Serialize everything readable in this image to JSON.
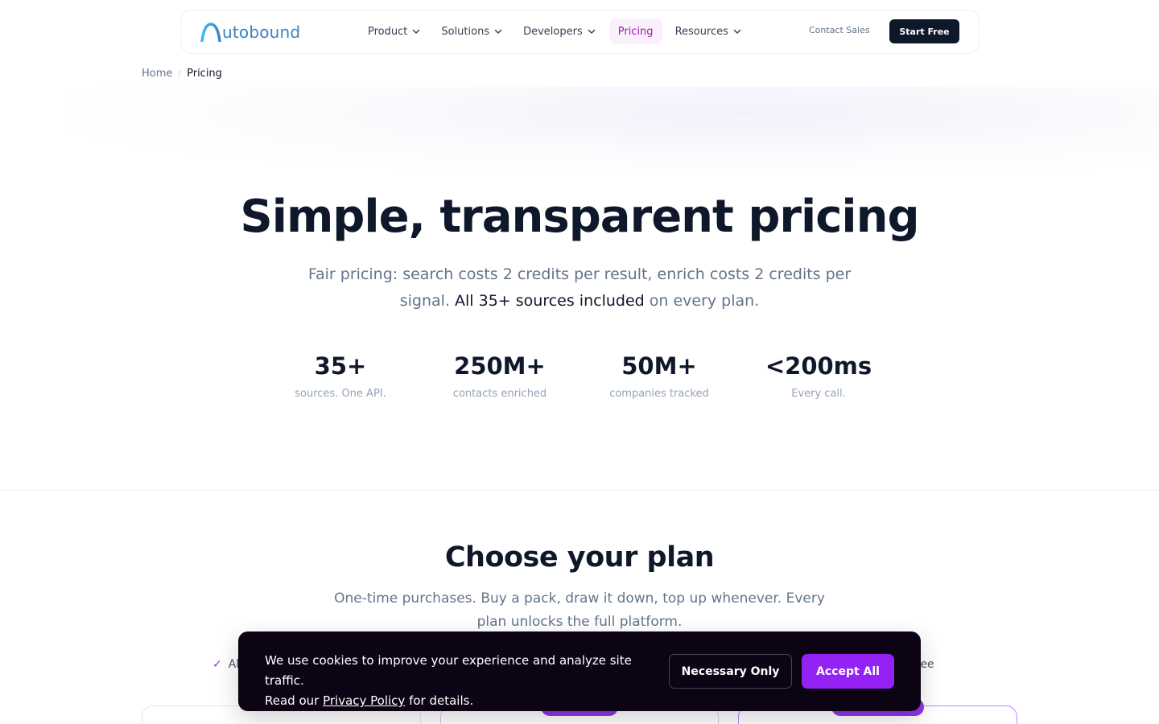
{
  "nav": {
    "logo_text": "utobound",
    "menu": [
      {
        "label": "Product",
        "has_dropdown": true
      },
      {
        "label": "Solutions",
        "has_dropdown": true
      },
      {
        "label": "Developers",
        "has_dropdown": true
      },
      {
        "label": "Pricing",
        "has_dropdown": false,
        "active": true
      },
      {
        "label": "Resources",
        "has_dropdown": true
      }
    ],
    "contact_sales": "Contact Sales",
    "start_free": "Start Free"
  },
  "breadcrumb": {
    "home": "Home",
    "separator": "/",
    "current": "Pricing"
  },
  "hero": {
    "title": "Simple, transparent pricing",
    "subtitle_pre": "Fair pricing: search costs 2 credits per result, enrich costs 2 credits per signal. ",
    "subtitle_strong": "All 35+ sources included",
    "subtitle_post": " on every plan."
  },
  "stats": [
    {
      "value": "35+",
      "label": "sources. One API."
    },
    {
      "value": "250M+",
      "label": "contacts enriched"
    },
    {
      "value": "50M+",
      "label": "companies tracked"
    },
    {
      "value": "<200ms",
      "label": "Every call."
    }
  ],
  "plans": {
    "title": "Choose your plan",
    "subtitle": "One-time purchases. Buy a pack, draw it down, top up whenever. Every plan unlocks the full platform.",
    "feature_left_partial": "Al",
    "feature_right_partial": "e free"
  },
  "cookie": {
    "text_line1": "We use cookies to improve your experience and analyze site traffic.",
    "text_read": "Read our ",
    "privacy_link": "Privacy Policy",
    "text_after": " for details.",
    "necessary_button": "Necessary Only",
    "accept_button": "Accept All"
  },
  "colors": {
    "brand_primary": "#0f172a",
    "accent_purple": "#9422f5",
    "logo_blue": "#3b82c4",
    "active_nav_text": "#a21caf",
    "active_nav_bg": "#faf0fb",
    "cookie_bg": "#0c0414"
  },
  "icons": [
    "autobound-logo-icon",
    "chevron-down-icon",
    "check-icon"
  ]
}
